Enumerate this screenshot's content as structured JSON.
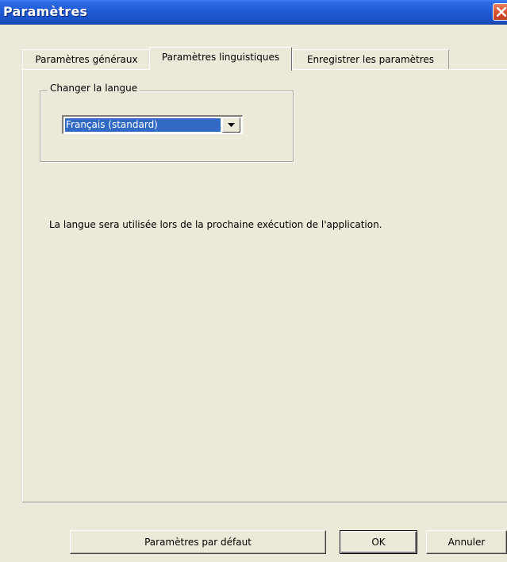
{
  "window": {
    "title": "Paramètres"
  },
  "tabs": [
    {
      "label": "Paramètres généraux",
      "active": false
    },
    {
      "label": "Paramètres linguistiques",
      "active": true
    },
    {
      "label": "Enregistrer les paramètres",
      "active": false
    }
  ],
  "language": {
    "group_label": "Changer la langue",
    "selected": "Français (standard)",
    "info": "La langue sera utilisée lors de la prochaine exécution de l'application."
  },
  "buttons": {
    "defaults": "Paramètres par défaut",
    "ok": "OK",
    "cancel": "Annuler"
  },
  "colors": {
    "titlebar": "#2a68e0",
    "selection": "#316ac5",
    "face": "#ece9d8"
  },
  "icons": {
    "close": "close-icon",
    "dropdown": "chevron-down-icon"
  }
}
